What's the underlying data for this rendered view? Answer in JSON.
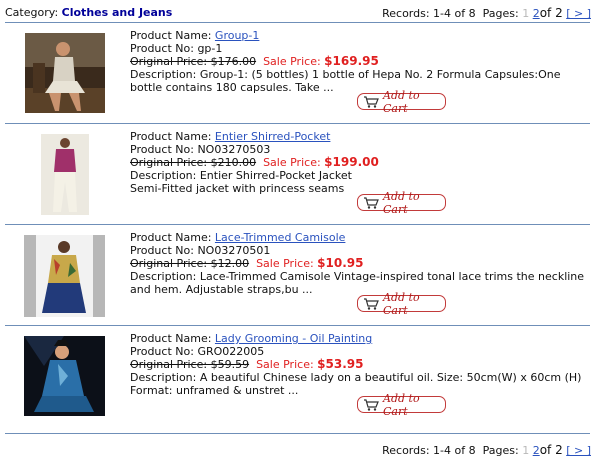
{
  "category": {
    "label": "Category:",
    "name": "Clothes and Jeans"
  },
  "pager": {
    "records": "Records: 1-4 of 8",
    "pages_label": "Pages:",
    "page1": "1",
    "page2": "2",
    "of_total": "of 2",
    "next": "[ > ]"
  },
  "products": [
    {
      "name_label": "Product Name:",
      "name": "Group-1",
      "no_label": "Product No:",
      "no": "gp-1",
      "original": "Original Price: $176.00",
      "sale_label": "Sale Price:",
      "sale": "$169.95",
      "description": "Description: Group-1: (5 bottles) 1 bottle of Hepa No. 2 Formula Capsules:One bottle contains 180 capsules. Take ...",
      "cart_label": "Add to Cart"
    },
    {
      "name_label": "Product Name:",
      "name": "Entier Shirred-Pocket",
      "no_label": "Product No:",
      "no": "NO03270503",
      "original": "Original Price: $210.00",
      "sale_label": "Sale Price:",
      "sale": "$199.00",
      "description": "Description: Entier Shirred-Pocket Jacket Semi-Fitted jacket with princess seams",
      "cart_label": "Add to Cart"
    },
    {
      "name_label": "Product Name:",
      "name": "Lace-Trimmed Camisole",
      "no_label": "Product No:",
      "no": "NO03270501",
      "original": "Original Price: $12.00",
      "sale_label": "Sale Price:",
      "sale": "$10.95",
      "description": "Description: Lace-Trimmed Camisole Vintage-inspired tonal lace trims the neckline and hem. Adjustable straps,bu ...",
      "cart_label": "Add to Cart"
    },
    {
      "name_label": "Product Name:",
      "name": "Lady Grooming - Oil Painting",
      "no_label": "Product No:",
      "no": "GRO022005",
      "original": "Original Price: $59.59",
      "sale_label": "Sale Price:",
      "sale": "$53.95",
      "description": "Description: A beautiful Chinese lady on a beautiful oil. Size: 50cm(W) x 60cm (H) Format: unframed & unstret ...",
      "cart_label": "Add to Cart"
    }
  ],
  "colors": {
    "link": "#2a52be",
    "category": "#000099",
    "sale": "#e02020",
    "rule": "#6f8fb8"
  }
}
